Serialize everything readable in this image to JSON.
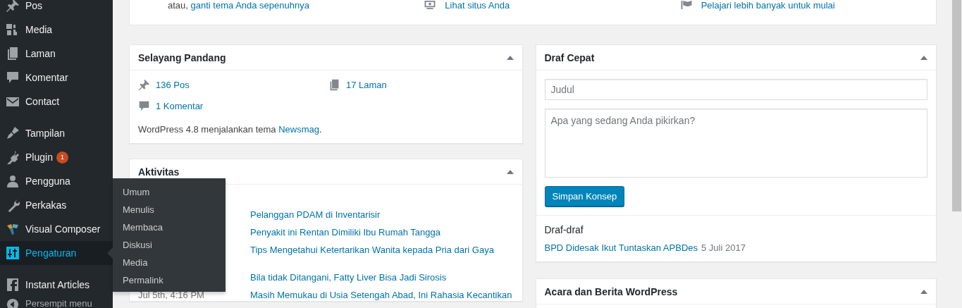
{
  "sidebar": {
    "items": [
      {
        "kind": "item",
        "label": "Pos",
        "selected": false
      },
      {
        "kind": "item",
        "label": "Media",
        "selected": false
      },
      {
        "kind": "item",
        "label": "Laman",
        "selected": false
      },
      {
        "kind": "item",
        "label": "Komentar",
        "selected": false
      },
      {
        "kind": "item",
        "label": "Contact",
        "selected": false
      },
      {
        "kind": "separator"
      },
      {
        "kind": "item",
        "label": "Tampilan",
        "selected": false
      },
      {
        "kind": "item",
        "label": "Plugin",
        "selected": false,
        "badge": "1"
      },
      {
        "kind": "item",
        "label": "Pengguna",
        "selected": false
      },
      {
        "kind": "item",
        "label": "Perkakas",
        "selected": false
      },
      {
        "kind": "item",
        "label": "Visual Composer",
        "selected": false
      },
      {
        "kind": "item",
        "label": "Pengaturan",
        "selected": true,
        "submenu": [
          {
            "label": "Umum",
            "selected": false
          },
          {
            "label": "Menulis",
            "selected": false
          },
          {
            "label": "Membaca",
            "selected": false
          },
          {
            "label": "Diskusi",
            "selected": false
          },
          {
            "label": "Media",
            "selected": false
          },
          {
            "label": "Permalink",
            "selected": false
          }
        ]
      },
      {
        "kind": "separator"
      },
      {
        "kind": "item",
        "label": "Instant Articles",
        "selected": false
      },
      {
        "kind": "collapse",
        "label": "Persempit menu"
      }
    ]
  },
  "welcome": {
    "columns": [
      {
        "text": "atau,",
        "link": "ganti tema Anda sepenuhnya"
      },
      {
        "link": "Lihat situs Anda"
      },
      {
        "link": "Pelajari lebih banyak untuk mulai"
      }
    ]
  },
  "at_a_glance": {
    "title": "Selayang Pandang",
    "items": [
      "136 Pos",
      "17 Laman",
      "1 Komentar"
    ],
    "footer": {
      "text": "WordPress 4.8 menjalankan tema",
      "link": "Newsmag",
      "after": "."
    }
  },
  "activity": {
    "title": "Aktivitas",
    "groups": [
      {
        "rows": [
          {
            "title": "Pelanggan PDAM di Inventarisir"
          },
          {
            "title": "Penyakit ini Rentan Dimiliki Ibu Rumah Tangga"
          },
          {
            "title": "Tips Mengetahui Ketertarikan Wanita kepada Pria dari Gaya"
          }
        ]
      },
      {
        "rows": [
          {
            "title": "Bila tidak Ditangani, Fatty Liver Bisa Jadi Sirosis"
          },
          {
            "date": "Jul 5th, 4:16 PM",
            "title": "Masih Memukau di Usia Setengah Abad, Ini Rahasia Kecantikan"
          }
        ]
      }
    ]
  },
  "quick_draft": {
    "title": "Draf Cepat",
    "title_field": {
      "placeholder": "Judul"
    },
    "content_field": {
      "placeholder": "Apa yang sedang Anda pikirkan?"
    },
    "button": "Simpan Konsep",
    "drafts_heading": "Draf-draf",
    "drafts": [
      {
        "title": "BPD Didesak Ikut Tuntaskan APBDes",
        "date": "5 Juli 2017"
      }
    ]
  },
  "events": {
    "title": "Acara dan Berita WordPress"
  }
}
